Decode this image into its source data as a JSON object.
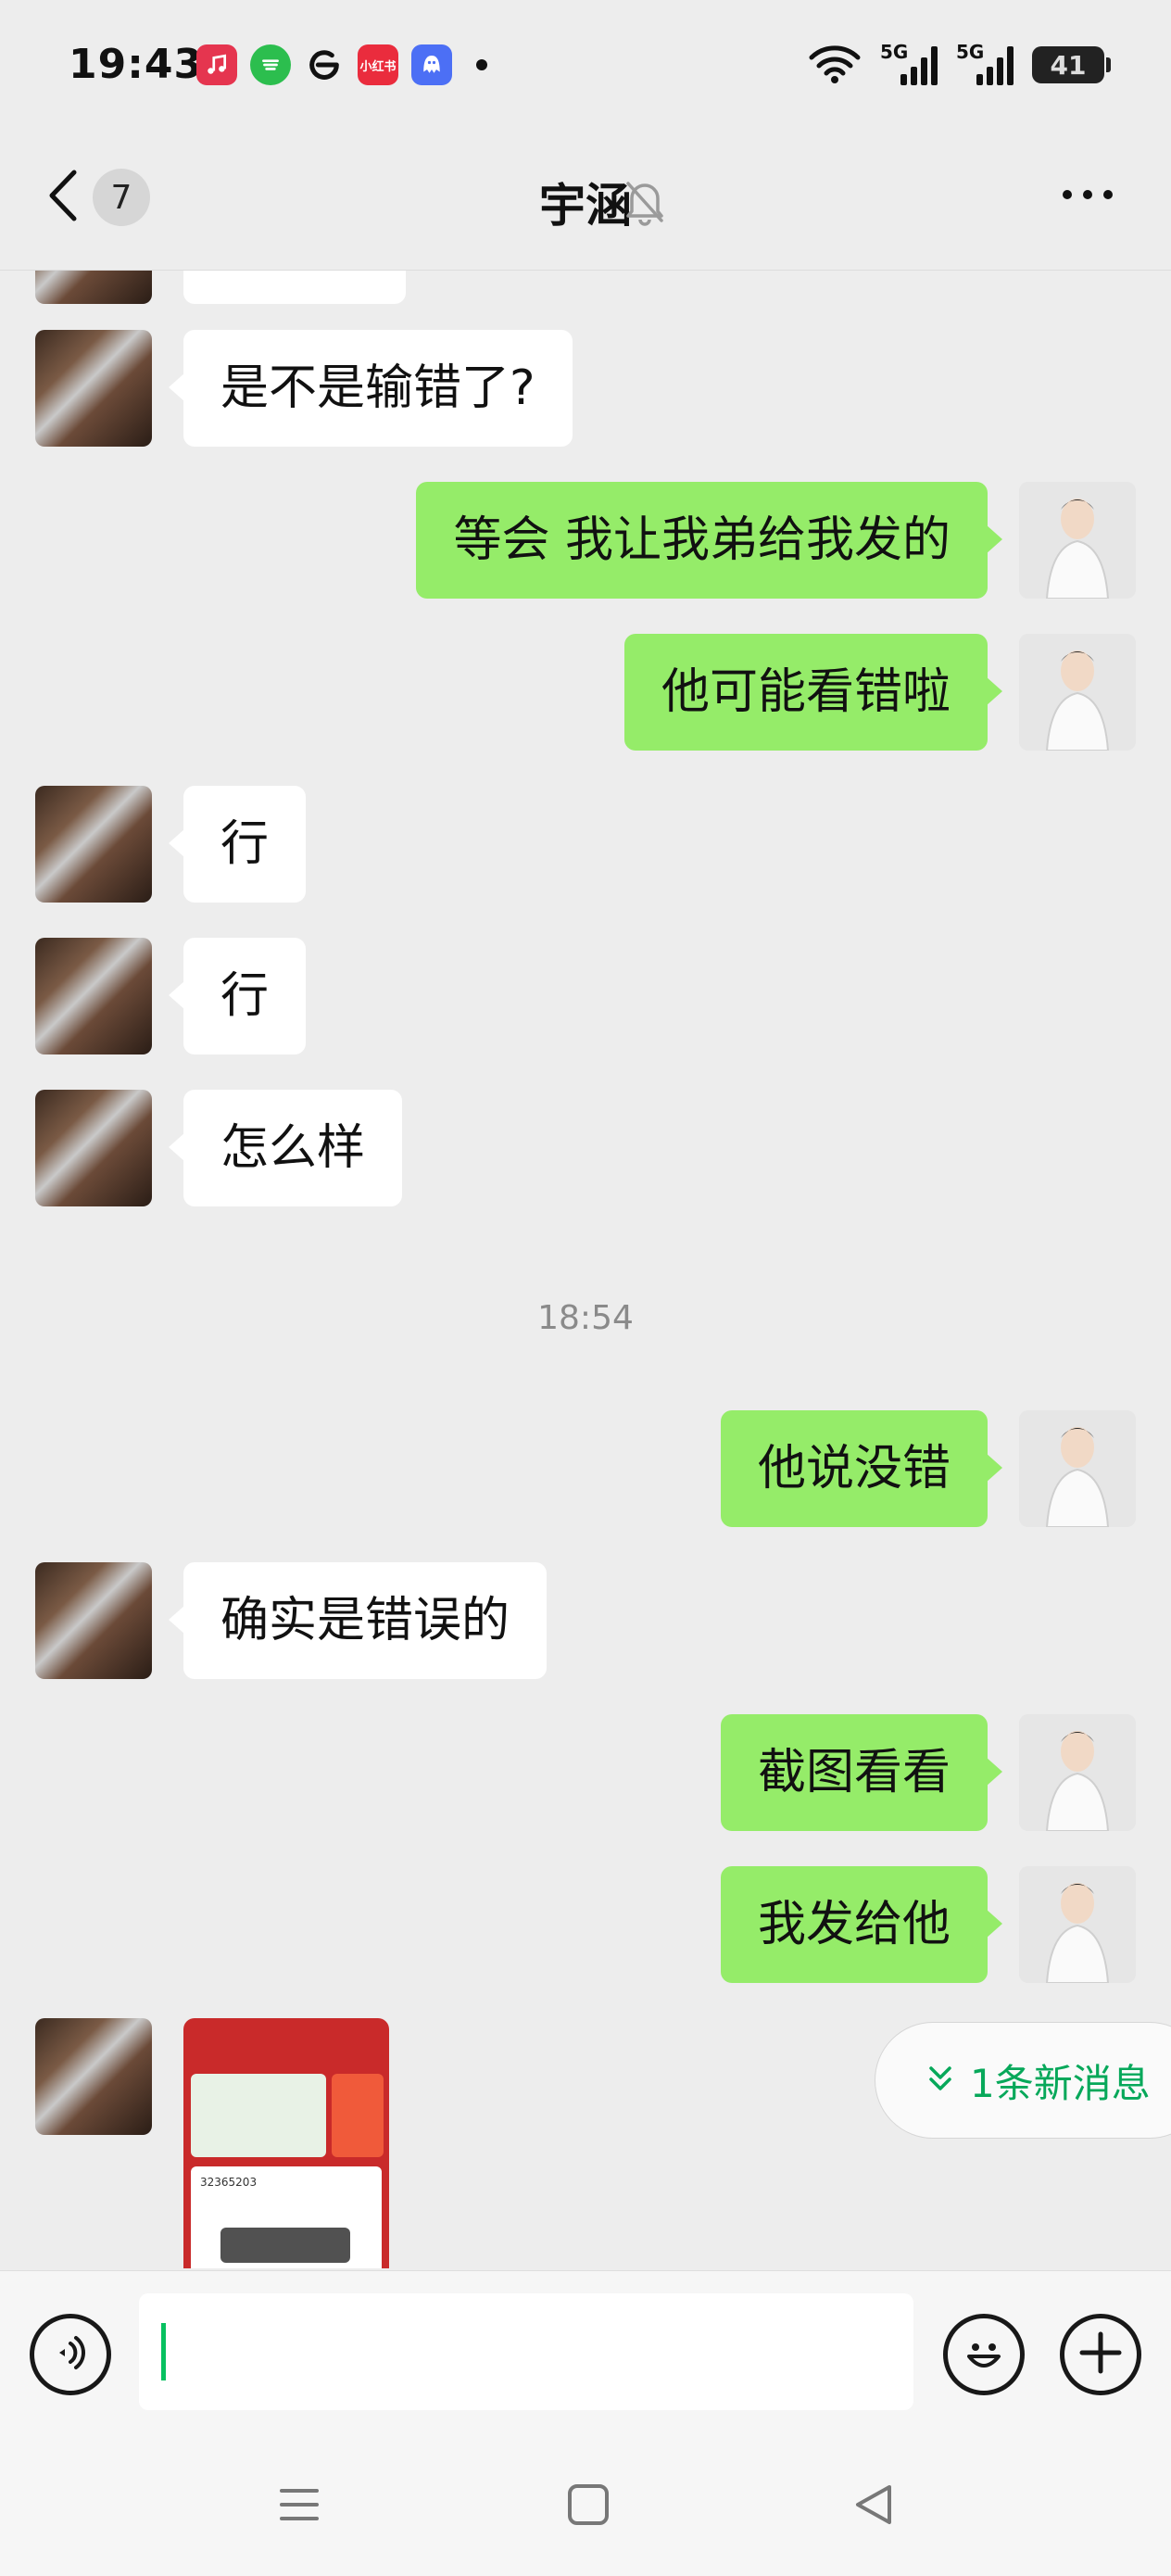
{
  "status_bar": {
    "time": "19:43",
    "apps": [
      {
        "icon": "music-icon",
        "color": "#e5354f"
      },
      {
        "icon": "chat-icon",
        "color": "#2cbe4e"
      },
      {
        "icon": "edge-icon",
        "color": "#111111"
      },
      {
        "icon": "xiaohongshu-icon",
        "label": "小红书",
        "color": "#ea2c3d"
      },
      {
        "icon": "qq-icon",
        "color": "#4c6ff5"
      }
    ],
    "network_1": "5G",
    "network_2": "5G",
    "battery": "41"
  },
  "nav": {
    "unread_count": "7",
    "title": "宇涵"
  },
  "messages": [
    {
      "side": "left",
      "text": "是不是输错了?"
    },
    {
      "side": "right",
      "text": "等会  我让我弟给我发的"
    },
    {
      "side": "right",
      "text": "他可能看错啦"
    },
    {
      "side": "left",
      "text": "行"
    },
    {
      "side": "left",
      "text": "行"
    },
    {
      "side": "left",
      "text": "怎么样"
    },
    {
      "side": "time",
      "text": "18:54"
    },
    {
      "side": "right",
      "text": "他说没错"
    },
    {
      "side": "left",
      "text": "确实是错误的"
    },
    {
      "side": "right",
      "text": "截图看看"
    },
    {
      "side": "right",
      "text": "我发给他"
    }
  ],
  "screenshot_preview": {
    "field_value": "32365203"
  },
  "new_message_pill": "1条新消息",
  "input": {
    "value": ""
  },
  "colors": {
    "background": "#ededed",
    "bubble_self": "#95ec69",
    "bubble_other": "#ffffff",
    "accent": "#07c160"
  }
}
